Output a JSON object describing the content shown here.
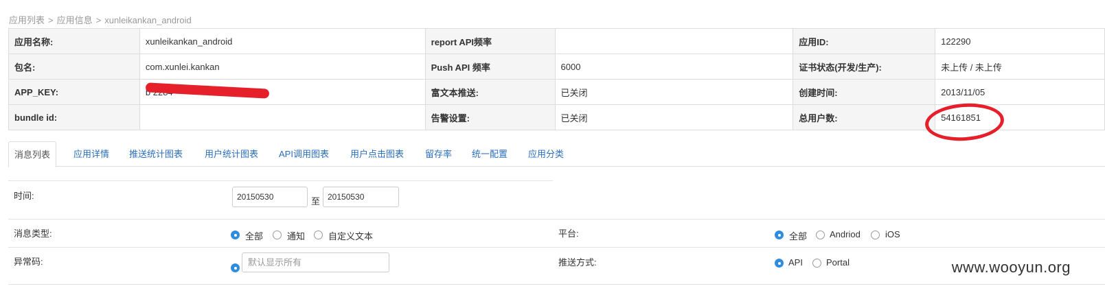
{
  "breadcrumb": {
    "items": [
      "应用列表",
      "应用信息",
      "xunleikankan_android"
    ],
    "separator": ">"
  },
  "info_table": {
    "rows": [
      [
        {
          "label": "应用名称:",
          "value": "xunleikankan_android"
        },
        {
          "label": "report API频率",
          "value": ""
        },
        {
          "label": "应用ID:",
          "value": "122290"
        }
      ],
      [
        {
          "label": "包名:",
          "value": "com.xunlei.kankan"
        },
        {
          "label": "Push API 频率",
          "value": "6000"
        },
        {
          "label": "证书状态(开发/生产):",
          "value": "未上传 / 未上传"
        }
      ],
      [
        {
          "label": "APP_KEY:",
          "value": "b                    2284"
        },
        {
          "label": "富文本推送:",
          "value": "已关闭"
        },
        {
          "label": "创建时间:",
          "value": "2013/11/05"
        }
      ],
      [
        {
          "label": "bundle id:",
          "value": ""
        },
        {
          "label": "告警设置:",
          "value": "已关闭"
        },
        {
          "label": "总用户数:",
          "value": "54161851"
        }
      ]
    ]
  },
  "tabs": [
    {
      "label": "消息列表",
      "active": true
    },
    {
      "label": "应用详情",
      "active": false
    },
    {
      "label": "推送统计图表",
      "active": false
    },
    {
      "label": "用户统计图表",
      "active": false
    },
    {
      "label": "API调用图表",
      "active": false
    },
    {
      "label": "用户点击图表",
      "active": false
    },
    {
      "label": "留存率",
      "active": false
    },
    {
      "label": "统一配置",
      "active": false
    },
    {
      "label": "应用分类",
      "active": false
    }
  ],
  "filters": {
    "time_label": "时间:",
    "date_from": "20150530",
    "date_to_sep": "至",
    "date_to": "20150530",
    "msg_type_label": "消息类型:",
    "msg_type_options": [
      {
        "label": "全部",
        "checked": true
      },
      {
        "label": "通知",
        "checked": false
      },
      {
        "label": "自定义文本",
        "checked": false
      }
    ],
    "platform_label": "平台:",
    "platform_options": [
      {
        "label": "全部",
        "checked": true
      },
      {
        "label": "Andriod",
        "checked": false
      },
      {
        "label": "iOS",
        "checked": false
      }
    ],
    "error_code_label": "异常码:",
    "error_code_placeholder": "默认显示所有",
    "push_method_label": "推送方式:",
    "push_method_options": [
      {
        "label": "API",
        "checked": true
      },
      {
        "label": "Portal",
        "checked": false
      }
    ]
  },
  "watermark": "www.wooyun.org",
  "colors": {
    "link": "#2a6ebb",
    "radio_checked": "#2f8cdf",
    "annotation_red": "#e5202b"
  }
}
